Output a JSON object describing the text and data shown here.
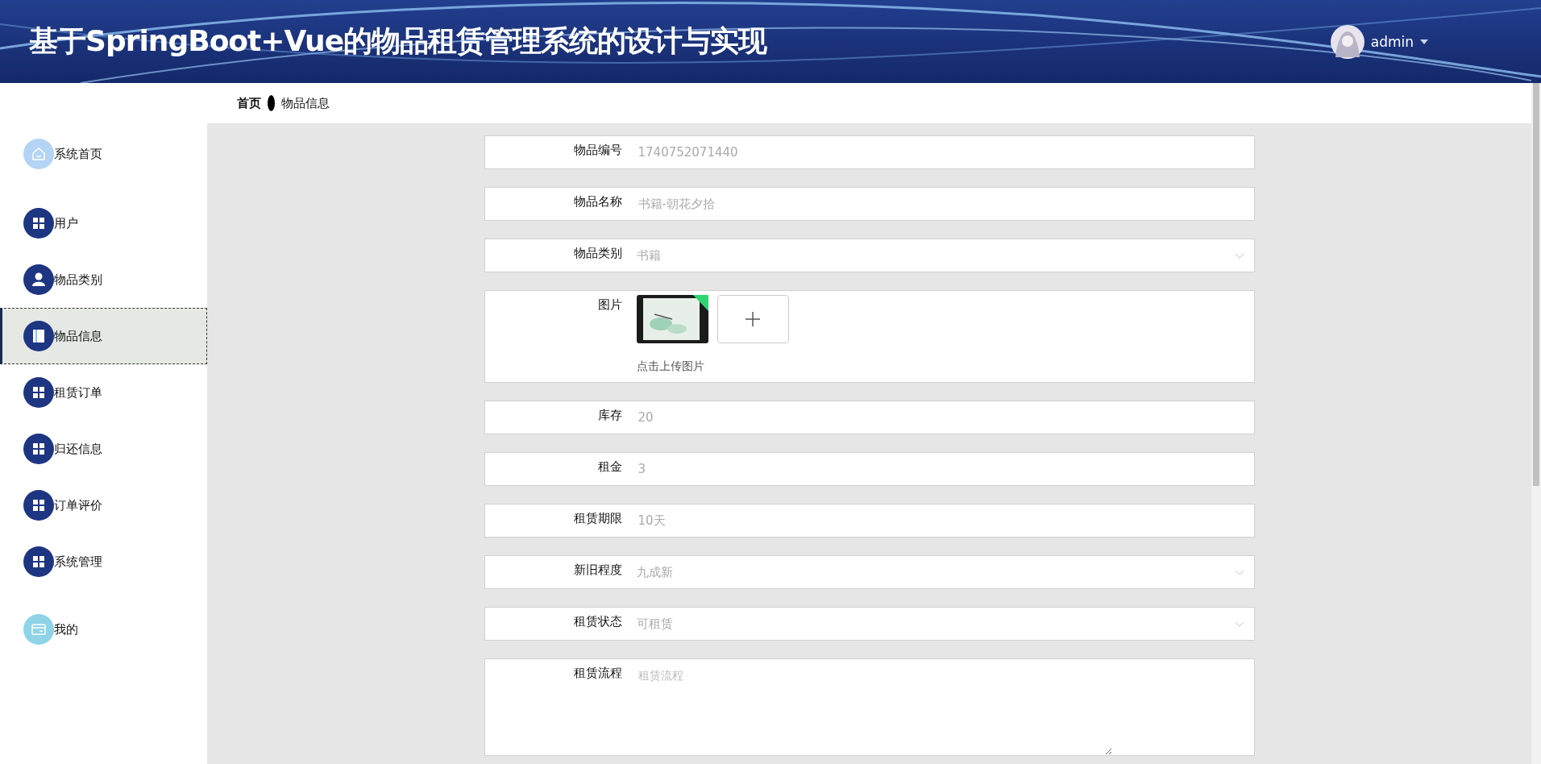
{
  "header": {
    "title": "基于SpringBoot+Vue的物品租赁管理系统的设计与实现",
    "user": "admin"
  },
  "breadcrumb": [
    "首页",
    "物品信息"
  ],
  "sidebar": {
    "items": [
      {
        "label": "系统首页",
        "color": "#b3d4f4",
        "selected": false
      },
      {
        "label": "用户",
        "color": "#1e3582",
        "selected": false
      },
      {
        "label": "物品类别",
        "color": "#1e3582",
        "selected": false
      },
      {
        "label": "物品信息",
        "color": "#1e3582",
        "selected": true
      },
      {
        "label": "租赁订单",
        "color": "#1e3582",
        "selected": false
      },
      {
        "label": "归还信息",
        "color": "#1e3582",
        "selected": false
      },
      {
        "label": "订单评价",
        "color": "#1e3582",
        "selected": false
      },
      {
        "label": "系统管理",
        "color": "#1e3582",
        "selected": false
      },
      {
        "label": "我的",
        "color": "#8fd3e8",
        "selected": false
      }
    ]
  },
  "form": {
    "fields": [
      {
        "kind": "text",
        "label": "物品编号",
        "value": "1740752071440"
      },
      {
        "kind": "text",
        "label": "物品名称",
        "value": "书籍-朝花夕拾"
      },
      {
        "kind": "select",
        "label": "物品类别",
        "value": "书籍"
      },
      {
        "label": "图片",
        "hint": "点击上传图片"
      },
      {
        "kind": "text",
        "label": "库存",
        "value": "20"
      },
      {
        "kind": "text",
        "label": "租金",
        "value": "3"
      },
      {
        "kind": "text",
        "label": "租赁期限",
        "value": "10天"
      },
      {
        "kind": "select",
        "label": "新旧程度",
        "value": "九成新"
      },
      {
        "kind": "select",
        "label": "租赁状态",
        "value": "可租赁"
      },
      {
        "kind": "textarea",
        "label": "租赁流程",
        "placeholder": "租赁流程"
      }
    ]
  }
}
